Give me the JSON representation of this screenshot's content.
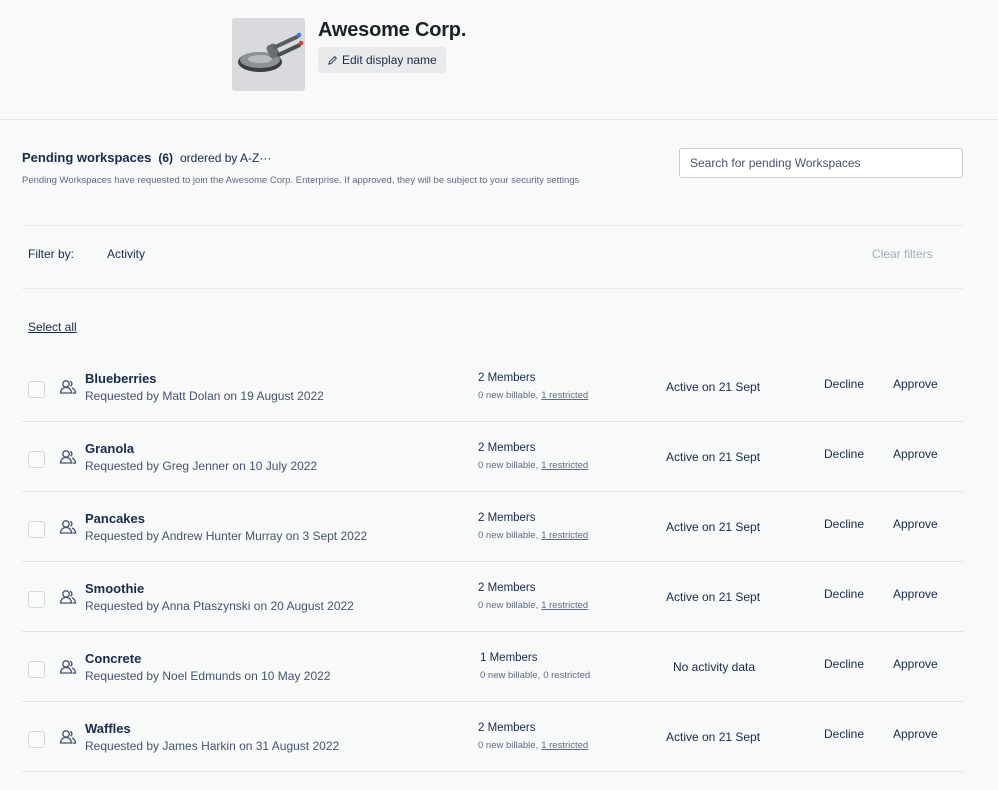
{
  "org": {
    "name": "Awesome Corp.",
    "edit_label": "Edit display name",
    "edit_icon": "pencil-icon",
    "logo_icon": "starship-logo"
  },
  "section": {
    "title": "Pending workspaces",
    "count": "(6)",
    "order": "ordered by A-Z···",
    "description": "Pending Workspaces have requested to join the Awesome Corp. Enterprise. If approved, they will be subject to your security settings",
    "search_placeholder": "Search for pending Workspaces"
  },
  "filters": {
    "label": "Filter by:",
    "activity": "Activity",
    "clear": "Clear filters"
  },
  "select_all": "Select all",
  "rows": [
    {
      "name": "Blueberries",
      "requested": "Requested by Matt Dolan on 19 August 2022",
      "members": "2 Members",
      "billable": "0 new billable,",
      "restricted": "1 restricted",
      "activity": "Active on 21 Sept",
      "decline": "Decline",
      "approve": "Approve"
    },
    {
      "name": "Granola",
      "requested": "Requested by Greg Jenner on 10 July 2022",
      "members": "2 Members",
      "billable": "0 new billable,",
      "restricted": "1 restricted",
      "activity": "Active on 21 Sept",
      "decline": "Decline",
      "approve": "Approve"
    },
    {
      "name": "Pancakes",
      "requested": "Requested by Andrew Hunter Murray on 3 Sept 2022",
      "members": "2 Members",
      "billable": "0 new billable,",
      "restricted": "1 restricted",
      "activity": "Active on 21 Sept",
      "decline": "Decline",
      "approve": "Approve"
    },
    {
      "name": "Smoothie",
      "requested": "Requested by Anna Ptaszynski on 20 August 2022",
      "members": "2 Members",
      "billable": "0 new billable,",
      "restricted": "1 restricted",
      "activity": "Active on 21 Sept",
      "decline": "Decline",
      "approve": "Approve"
    },
    {
      "name": "Concrete",
      "requested": "Requested by Noel Edmunds on 10 May 2022",
      "members": "1 Members",
      "billable": "0 new billable,",
      "restricted": "0 restricted",
      "activity": "No activity data",
      "decline": "Decline",
      "approve": "Approve"
    },
    {
      "name": "Waffles",
      "requested": "Requested by James Harkin on 31 August 2022",
      "members": "2 Members",
      "billable": "0 new billable,",
      "restricted": "1 restricted",
      "activity": "Active on 21 Sept",
      "decline": "Decline",
      "approve": "Approve"
    }
  ]
}
